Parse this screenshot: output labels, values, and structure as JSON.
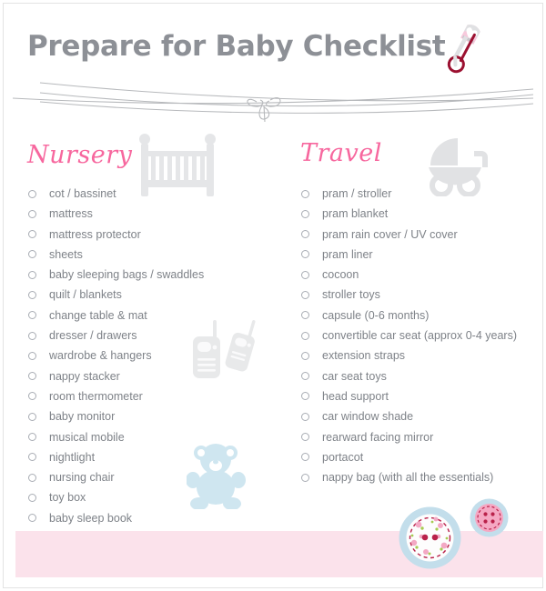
{
  "page": {
    "title": "Prepare for Baby Checklist",
    "accent_pink": "#F7679E",
    "band_pink": "#FBE2EB",
    "text_gray": "#7E8288",
    "title_gray": "#8D9096",
    "icon_gray": "#E3E4E6",
    "icon_blue": "#CFE6F0"
  },
  "header": {
    "title": "Prepare for Baby Checklist",
    "pin_icon": "safety-pin-icon",
    "ribbon_icon": "ribbon-bow-divider-icon"
  },
  "columns": [
    {
      "id": "nursery",
      "heading": "Nursery",
      "decor_icon": "crib-icon",
      "items": [
        "cot / bassinet",
        "mattress",
        "mattress protector",
        "sheets",
        "baby sleeping bags / swaddles",
        "quilt / blankets",
        "change table & mat",
        "dresser / drawers",
        "wardrobe & hangers",
        "nappy stacker",
        "room thermometer",
        "baby monitor",
        "musical mobile",
        "nightlight",
        "nursing chair",
        "toy box",
        "baby sleep book"
      ]
    },
    {
      "id": "travel",
      "heading": "Travel",
      "decor_icon": "pram-icon",
      "items": [
        "pram / stroller",
        "pram blanket",
        "pram rain cover / UV cover",
        "pram liner",
        "cocoon",
        "stroller toys",
        "capsule (0-6 months)",
        "convertible car seat (approx 0-4 years)",
        "extension straps",
        "car seat toys",
        "head support",
        "car window shade",
        "rearward facing mirror",
        "portacot",
        "nappy bag (with all the essentials)"
      ]
    }
  ],
  "decorations": {
    "baby_monitor_icon": "baby-monitor-icon",
    "teddy_bear_icon": "teddy-bear-icon",
    "big_button_icon": "floral-button-icon",
    "small_button_icon": "pink-button-icon"
  }
}
